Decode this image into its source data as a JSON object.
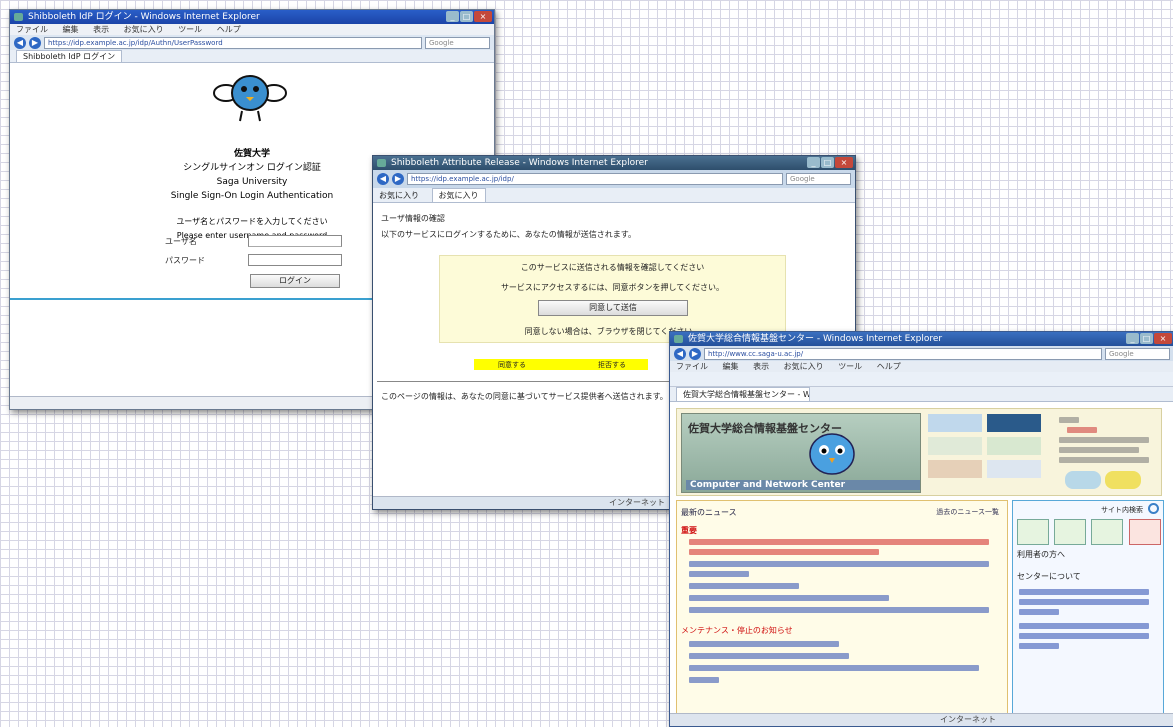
{
  "window1": {
    "title": "Shibboleth IdP ログイン - Windows Internet Explorer",
    "menu": [
      "ファイル",
      "編集",
      "表示",
      "お気に入り",
      "ツール",
      "ヘルプ"
    ],
    "url": "https://idp.example.ac.jp/idp/Authn/UserPassword",
    "search_placeholder": "Google",
    "tab_label": "Shibboleth IdP ログイン",
    "heading1": "佐賀大学",
    "heading2": "シングルサインオン ログイン認証",
    "heading3": "Saga University",
    "heading4": "Single Sign-On Login Authentication",
    "notice1": "ユーザ名とパスワードを入力してください",
    "notice2": "Please enter username and password",
    "user_label": "ユーザ名",
    "pass_label": "パスワード",
    "login_button": "ログイン"
  },
  "window2": {
    "title": "Shibboleth Attribute Release - Windows Internet Explorer",
    "url": "https://idp.example.ac.jp/idp/",
    "search_placeholder": "Google",
    "fav_label": "お気に入り",
    "tab_label": "お気に入り",
    "line1": "ユーザ情報の確認",
    "line2": "以下のサービスにログインするために、あなたの情報が送信されます。",
    "box_line1": "このサービスに送信される情報を確認してください",
    "box_line2": "サービスにアクセスするには、同意ボタンを押してください。",
    "box_button": "同意して送信",
    "box_line3": "同意しない場合は、ブラウザを閉じてください。",
    "yellow_a": "同意する",
    "yellow_b": "拒否する",
    "bottom_text": "このページの情報は、あなたの同意に基づいてサービス提供者へ送信されます。",
    "status": "インターネット"
  },
  "window3": {
    "title": "佐賀大学総合情報基盤センター - Windows Internet Explorer",
    "menu": [
      "ファイル",
      "編集",
      "表示",
      "お気に入り",
      "ツール",
      "ヘルプ"
    ],
    "url": "http://www.cc.saga-u.ac.jp/",
    "search_placeholder": "Google",
    "banner_title": "佐賀大学総合情報基盤センター",
    "banner_sub": "Computer and Network Center",
    "left_header": "最新のニュース",
    "left_header_right": "過去のニュース一覧",
    "left_section_title": "重要",
    "left_section_title2": "メンテナンス・停止のお知らせ",
    "right_header": "サイト内検索",
    "right_label1": "利用者の方へ",
    "right_label2": "センターについて",
    "status": "インターネット"
  }
}
